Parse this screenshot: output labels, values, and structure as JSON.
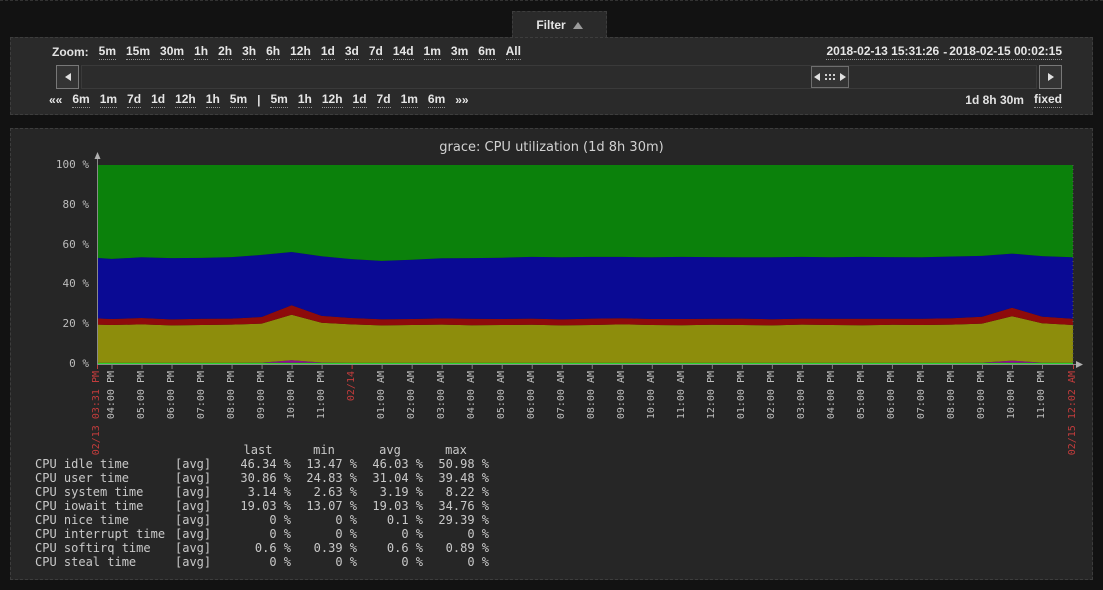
{
  "filter_tab": {
    "label": "Filter"
  },
  "toolbar": {
    "zoom_label": "Zoom:",
    "zoom_links": [
      "5m",
      "15m",
      "30m",
      "1h",
      "2h",
      "3h",
      "6h",
      "12h",
      "1d",
      "3d",
      "7d",
      "14d",
      "1m",
      "3m",
      "6m",
      "All"
    ],
    "date_range": {
      "from": "2018-02-13 15:31:26",
      "sep": "-",
      "to": "2018-02-15 00:02:15"
    },
    "nav_prev": "««",
    "nav_left": [
      "6m",
      "1m",
      "7d",
      "1d",
      "12h",
      "1h",
      "5m"
    ],
    "nav_sep": "|",
    "nav_right": [
      "5m",
      "1h",
      "12h",
      "1d",
      "7d",
      "1m",
      "6m"
    ],
    "nav_next": "»»",
    "period_label": "1d 8h 30m",
    "fixed_link": "fixed"
  },
  "chart_data": {
    "type": "area",
    "stacked": true,
    "title": "grace: CPU utilization (1d 8h 30m)",
    "ylim": [
      0,
      100
    ],
    "grid": true,
    "y_ticks": [
      "0 %",
      "20 %",
      "40 %",
      "60 %",
      "80 %",
      "100 %"
    ],
    "total_minutes": 1951,
    "x_minutes": [
      0,
      29,
      89,
      149,
      209,
      269,
      329,
      389,
      449,
      509,
      569,
      629,
      689,
      749,
      809,
      869,
      929,
      989,
      1049,
      1109,
      1169,
      1229,
      1289,
      1349,
      1409,
      1469,
      1529,
      1589,
      1649,
      1709,
      1769,
      1829,
      1889,
      1951
    ],
    "x_labels": [
      {
        "text": "02/13 03:31 PM",
        "red": true
      },
      {
        "text": "04:00 PM",
        "red": false
      },
      {
        "text": "05:00 PM",
        "red": false
      },
      {
        "text": "06:00 PM",
        "red": false
      },
      {
        "text": "07:00 PM",
        "red": false
      },
      {
        "text": "08:00 PM",
        "red": false
      },
      {
        "text": "09:00 PM",
        "red": false
      },
      {
        "text": "10:00 PM",
        "red": false
      },
      {
        "text": "11:00 PM",
        "red": false
      },
      {
        "text": "02/14",
        "red": true
      },
      {
        "text": "01:00 AM",
        "red": false
      },
      {
        "text": "02:00 AM",
        "red": false
      },
      {
        "text": "03:00 AM",
        "red": false
      },
      {
        "text": "04:00 AM",
        "red": false
      },
      {
        "text": "05:00 AM",
        "red": false
      },
      {
        "text": "06:00 AM",
        "red": false
      },
      {
        "text": "07:00 AM",
        "red": false
      },
      {
        "text": "08:00 AM",
        "red": false
      },
      {
        "text": "09:00 AM",
        "red": false
      },
      {
        "text": "10:00 AM",
        "red": false
      },
      {
        "text": "11:00 AM",
        "red": false
      },
      {
        "text": "12:00 PM",
        "red": false
      },
      {
        "text": "01:00 PM",
        "red": false
      },
      {
        "text": "02:00 PM",
        "red": false
      },
      {
        "text": "03:00 PM",
        "red": false
      },
      {
        "text": "04:00 PM",
        "red": false
      },
      {
        "text": "05:00 PM",
        "red": false
      },
      {
        "text": "06:00 PM",
        "red": false
      },
      {
        "text": "07:00 PM",
        "red": false
      },
      {
        "text": "08:00 PM",
        "red": false
      },
      {
        "text": "09:00 PM",
        "red": false
      },
      {
        "text": "10:00 PM",
        "red": false
      },
      {
        "text": "11:00 PM",
        "red": false
      },
      {
        "text": "02/15 12:02 AM",
        "red": true
      }
    ],
    "series": [
      {
        "name": "CPU softirq time",
        "color": "#2fd32f",
        "values": [
          0.6,
          0.6,
          0.6,
          0.6,
          0.6,
          0.6,
          0.6,
          0.6,
          0.6,
          0.6,
          0.6,
          0.6,
          0.6,
          0.6,
          0.6,
          0.6,
          0.6,
          0.6,
          0.6,
          0.6,
          0.6,
          0.6,
          0.6,
          0.6,
          0.6,
          0.6,
          0.6,
          0.6,
          0.6,
          0.6,
          0.6,
          0.6,
          0.6,
          0.6
        ]
      },
      {
        "name": "CPU nice time",
        "color": "#8f0f8f",
        "values": [
          0,
          0,
          0,
          0,
          0,
          0,
          0.1,
          1.3,
          0.15,
          0,
          0,
          0,
          0,
          0,
          0,
          0,
          0,
          0,
          0,
          0,
          0,
          0,
          0,
          0,
          0,
          0,
          0,
          0,
          0,
          0,
          0.1,
          1.1,
          0.1,
          0
        ]
      },
      {
        "name": "CPU interrupt time",
        "color": "#0f8686",
        "values": [
          0,
          0,
          0,
          0,
          0,
          0,
          0,
          0,
          0,
          0,
          0,
          0,
          0,
          0,
          0,
          0,
          0,
          0,
          0,
          0,
          0,
          0,
          0,
          0,
          0,
          0,
          0,
          0,
          0,
          0,
          0,
          0,
          0,
          0
        ]
      },
      {
        "name": "CPU steal time",
        "color": "#c85252",
        "values": [
          0,
          0,
          0,
          0,
          0,
          0,
          0,
          0,
          0,
          0,
          0,
          0,
          0,
          0,
          0,
          0,
          0,
          0,
          0,
          0,
          0,
          0,
          0,
          0,
          0,
          0,
          0,
          0,
          0,
          0,
          0,
          0,
          0,
          0
        ]
      },
      {
        "name": "CPU iowait time",
        "color": "#8d8d0c",
        "values": [
          19.2,
          19.0,
          19.3,
          18.8,
          19.0,
          19.2,
          19.6,
          22.8,
          20.0,
          19.3,
          18.8,
          19.0,
          19.2,
          18.9,
          19.0,
          19.1,
          18.8,
          19.0,
          19.3,
          19.0,
          18.9,
          19.1,
          19.0,
          18.8,
          19.2,
          19.0,
          18.9,
          19.1,
          19.0,
          19.2,
          19.6,
          22.3,
          19.8,
          19.0
        ]
      },
      {
        "name": "CPU system time",
        "color": "#8e0b0b",
        "values": [
          3.1,
          3.0,
          3.2,
          3.0,
          3.1,
          3.0,
          3.3,
          4.8,
          3.4,
          3.2,
          3.1,
          3.0,
          3.1,
          3.2,
          3.0,
          3.1,
          3.0,
          3.2,
          3.1,
          3.0,
          3.1,
          3.0,
          3.2,
          3.1,
          3.0,
          3.1,
          3.2,
          3.0,
          3.1,
          3.2,
          3.4,
          4.3,
          3.3,
          3.1
        ]
      },
      {
        "name": "CPU user time",
        "color": "#0a0a94",
        "values": [
          30.4,
          30.2,
          30.5,
          30.8,
          30.6,
          30.9,
          31.2,
          26.8,
          30.0,
          29.6,
          29.3,
          29.8,
          30.2,
          30.5,
          30.8,
          31.0,
          31.2,
          31.0,
          30.8,
          31.0,
          31.2,
          31.0,
          30.8,
          31.1,
          31.0,
          30.9,
          31.1,
          31.0,
          30.9,
          31.0,
          30.6,
          27.2,
          30.4,
          30.9
        ]
      },
      {
        "name": "CPU idle time",
        "color": "#0b810b",
        "values": [
          46.7,
          47.2,
          46.4,
          46.8,
          46.7,
          46.3,
          45.2,
          43.7,
          45.85,
          47.3,
          48.2,
          47.6,
          46.9,
          46.8,
          46.6,
          46.2,
          46.4,
          46.2,
          46.2,
          46.4,
          46.2,
          46.3,
          46.4,
          46.4,
          46.2,
          46.4,
          46.2,
          46.3,
          46.4,
          46.0,
          45.7,
          44.5,
          45.8,
          46.4
        ]
      }
    ],
    "legend": {
      "headers": [
        "last",
        "min",
        "avg",
        "max"
      ],
      "rows": [
        {
          "name": "CPU idle time",
          "func": "[avg]",
          "color": "#0b810b",
          "last": "46.34 %",
          "min": "13.47 %",
          "avg": "46.03 %",
          "max": "50.98 %"
        },
        {
          "name": "CPU user time",
          "func": "[avg]",
          "color": "#0a0a94",
          "last": "30.86 %",
          "min": "24.83 %",
          "avg": "31.04 %",
          "max": "39.48 %"
        },
        {
          "name": "CPU system time",
          "func": "[avg]",
          "color": "#8e0b0b",
          "last": "3.14 %",
          "min": "2.63 %",
          "avg": "3.19 %",
          "max": "8.22 %"
        },
        {
          "name": "CPU iowait time",
          "func": "[avg]",
          "color": "#8d8d0c",
          "last": "19.03 %",
          "min": "13.07 %",
          "avg": "19.03 %",
          "max": "34.76 %"
        },
        {
          "name": "CPU nice time",
          "func": "[avg]",
          "color": "#8f0f8f",
          "last": "0 %",
          "min": "0 %",
          "avg": "0.1 %",
          "max": "29.39 %"
        },
        {
          "name": "CPU interrupt time",
          "func": "[avg]",
          "color": "#0f8686",
          "last": "0 %",
          "min": "0 %",
          "avg": "0 %",
          "max": "0 %"
        },
        {
          "name": "CPU softirq time",
          "func": "[avg]",
          "color": "#2fd32f",
          "last": "0.6 %",
          "min": "0.39 %",
          "avg": "0.6 %",
          "max": "0.89 %"
        },
        {
          "name": "CPU steal time",
          "func": "[avg]",
          "color": "#c85252",
          "last": "0 %",
          "min": "0 %",
          "avg": "0 %",
          "max": "0 %"
        }
      ]
    }
  }
}
